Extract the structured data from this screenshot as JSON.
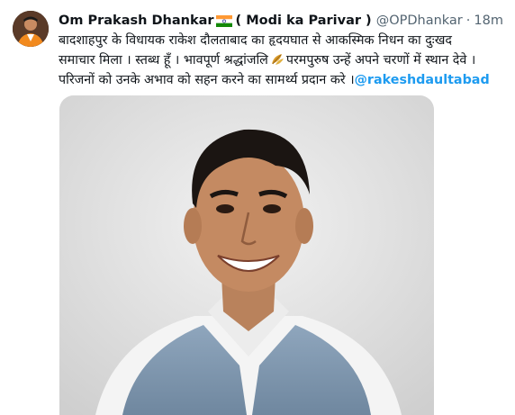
{
  "tweet": {
    "author": {
      "display_name": "Om Prakash Dhankar",
      "name_suffix": "( Modi ka Parivar )",
      "handle": "@OPDhankar",
      "separator": "·",
      "time": "18m",
      "flag_icon": "india-flag-icon",
      "avatar_icon": "profile-avatar"
    },
    "text": {
      "line1": "बादशाहपुर के विधायक राकेश दौलताबाद का हृदयघात से आकस्मिक निधन का दुःखद",
      "line2_before": "समाचार मिला । स्तब्ध हूँ । भावपूर्ण श्रद्धांजलि",
      "line2_after": "परमपुरुष उन्हें अपने चरणों में स्थान देवे ।",
      "line3_before": "परिजनों को उनके अभाव को सहन करने का सामर्थ्य प्रदान करे ।",
      "mention": "@rakeshdaultabad",
      "emoji_icon": "leaves-icon"
    },
    "media": {
      "type": "photo",
      "subject_icon": "portrait-photo"
    }
  },
  "colors": {
    "text_primary": "#0f1419",
    "text_secondary": "#536471",
    "mention": "#1d9bf0",
    "background": "#ffffff"
  }
}
